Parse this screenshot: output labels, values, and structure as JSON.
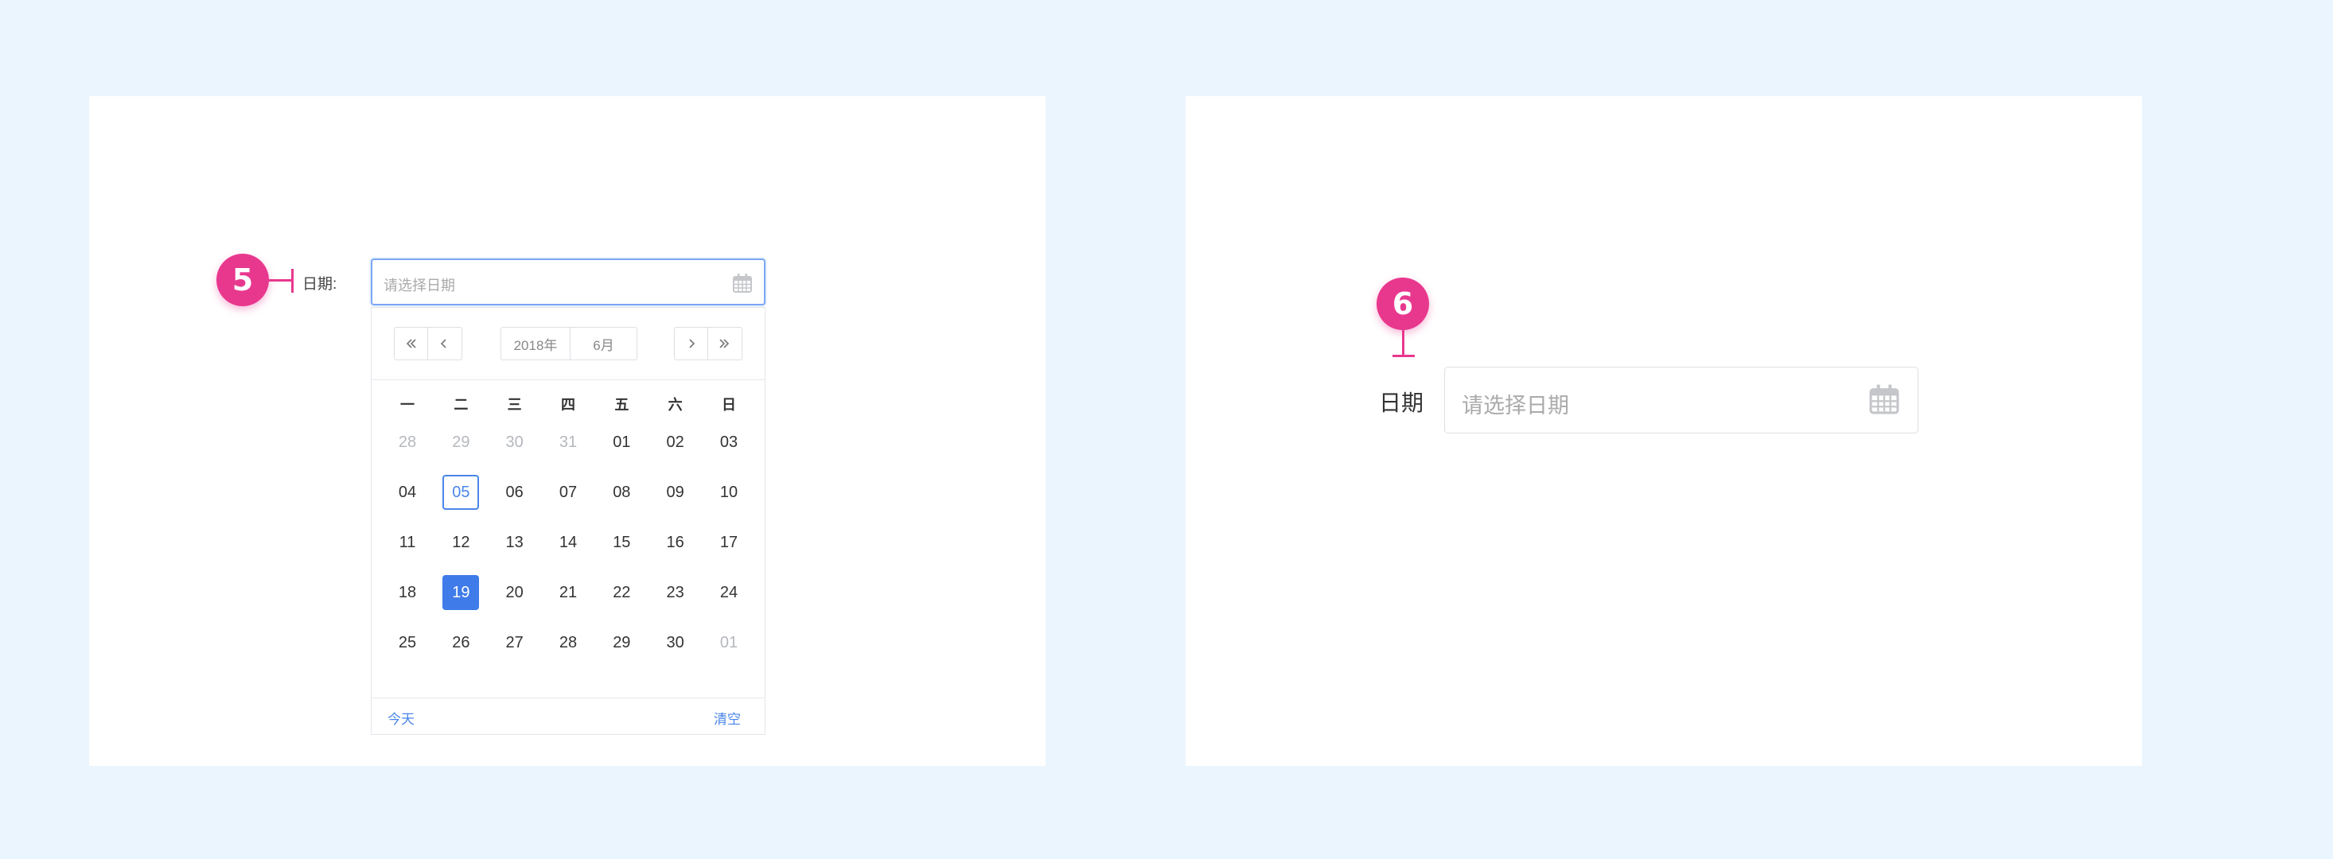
{
  "annotations": {
    "left_badge": "5",
    "right_badge": "6"
  },
  "left_panel": {
    "label": "日期:",
    "input_placeholder": "请选择日期",
    "calendar": {
      "year": "2018年",
      "month": "6月",
      "weekdays": [
        "一",
        "二",
        "三",
        "四",
        "五",
        "六",
        "日"
      ],
      "days": [
        {
          "t": "28",
          "muted": true
        },
        {
          "t": "29",
          "muted": true
        },
        {
          "t": "30",
          "muted": true
        },
        {
          "t": "31",
          "muted": true
        },
        {
          "t": "01"
        },
        {
          "t": "02"
        },
        {
          "t": "03"
        },
        {
          "t": "04"
        },
        {
          "t": "05",
          "today": true
        },
        {
          "t": "06"
        },
        {
          "t": "07"
        },
        {
          "t": "08"
        },
        {
          "t": "09"
        },
        {
          "t": "10"
        },
        {
          "t": "11"
        },
        {
          "t": "12"
        },
        {
          "t": "13"
        },
        {
          "t": "14"
        },
        {
          "t": "15"
        },
        {
          "t": "16"
        },
        {
          "t": "17"
        },
        {
          "t": "18"
        },
        {
          "t": "19",
          "selected": true
        },
        {
          "t": "20"
        },
        {
          "t": "21"
        },
        {
          "t": "22"
        },
        {
          "t": "23"
        },
        {
          "t": "24"
        },
        {
          "t": "25"
        },
        {
          "t": "26"
        },
        {
          "t": "27"
        },
        {
          "t": "28"
        },
        {
          "t": "29"
        },
        {
          "t": "30"
        },
        {
          "t": "01",
          "muted": true
        }
      ],
      "today_label": "今天",
      "clear_label": "清空"
    }
  },
  "right_panel": {
    "label": "日期",
    "input_placeholder": "请选择日期"
  },
  "colors": {
    "background": "#ebf5fe",
    "badge": "#e8388e",
    "accent": "#3f7be9"
  }
}
